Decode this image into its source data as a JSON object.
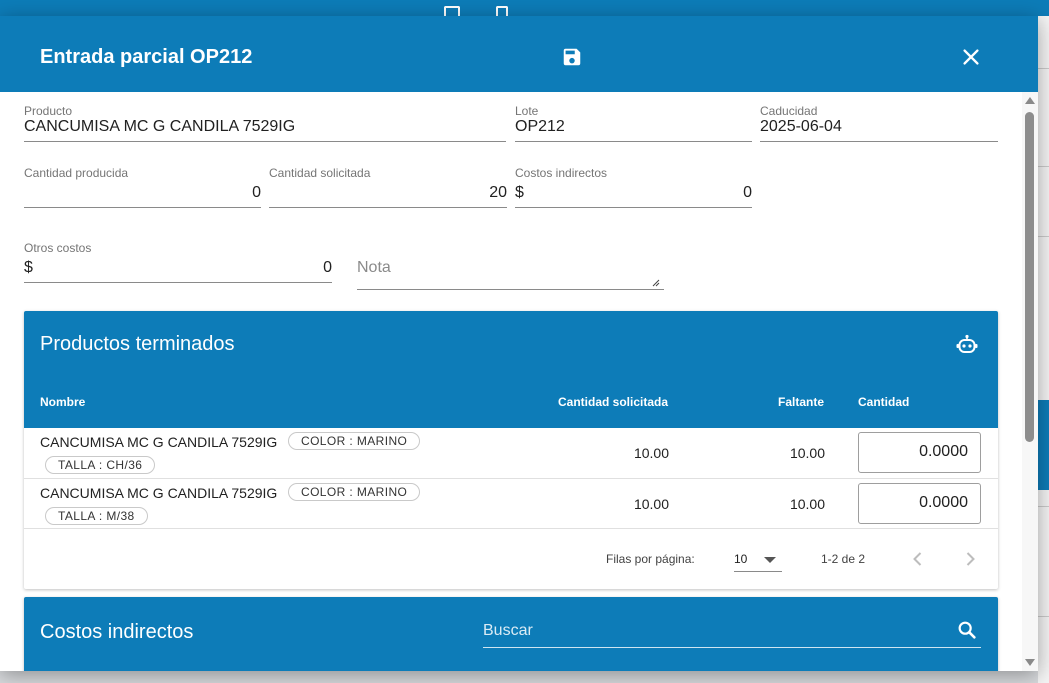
{
  "colors": {
    "primary": "#0d7cb8",
    "header_text": "#ffffff"
  },
  "dialog": {
    "title": "Entrada parcial OP212",
    "save_icon": "save-icon",
    "close_icon": "close-icon"
  },
  "form": {
    "producto": {
      "label": "Producto",
      "value": "CANCUMISA MC G CANDILA 7529IG"
    },
    "lote": {
      "label": "Lote",
      "value": "OP212"
    },
    "caducidad": {
      "label": "Caducidad",
      "value": "2025-06-04"
    },
    "cantidad_producida": {
      "label": "Cantidad producida",
      "value": "0"
    },
    "cantidad_solicitada": {
      "label": "Cantidad solicitada",
      "value": "20"
    },
    "costos_indirectos": {
      "label": "Costos indirectos",
      "prefix": "$",
      "value": "0"
    },
    "otros_costos": {
      "label": "Otros costos",
      "prefix": "$",
      "value": "0"
    },
    "nota": {
      "placeholder": "Nota"
    }
  },
  "productos_terminados": {
    "title": "Productos terminados",
    "action_icon": "robot-icon",
    "columns": {
      "nombre": "Nombre",
      "cantidad_solicitada": "Cantidad solicitada",
      "faltante": "Faltante",
      "cantidad": "Cantidad"
    },
    "rows": [
      {
        "nombre": "CANCUMISA MC G CANDILA 7529IG",
        "chips": [
          "COLOR : MARINO",
          "TALLA : CH/36"
        ],
        "cantidad_solicitada": "10.00",
        "faltante": "10.00",
        "cantidad": "0.0000"
      },
      {
        "nombre": "CANCUMISA MC G CANDILA 7529IG",
        "chips": [
          "COLOR : MARINO",
          "TALLA : M/38"
        ],
        "cantidad_solicitada": "10.00",
        "faltante": "10.00",
        "cantidad": "0.0000"
      }
    ],
    "pagination": {
      "rows_per_page_label": "Filas por página:",
      "rows_per_page": "10",
      "range": "1-2 de 2"
    }
  },
  "costos_indirectos_card": {
    "title": "Costos indirectos",
    "search_placeholder": "Buscar"
  }
}
